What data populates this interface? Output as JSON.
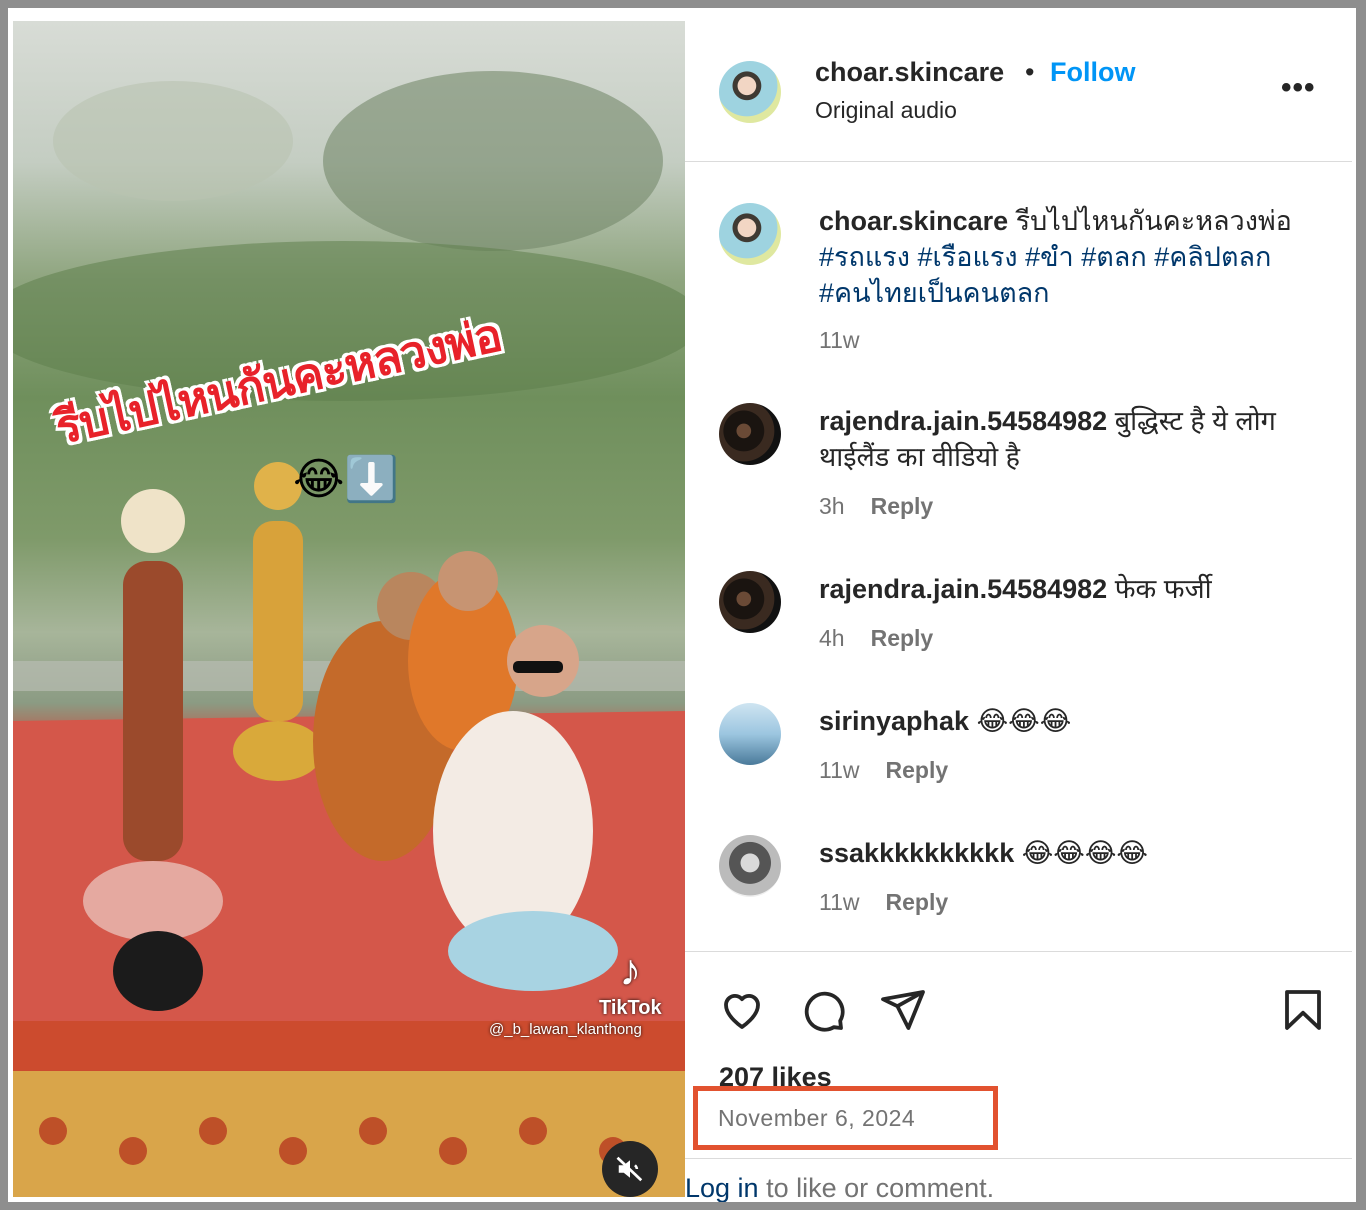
{
  "post": {
    "username": "choar.skincare",
    "follow_label": "Follow",
    "separator": "•",
    "audio": "Original audio",
    "more_label": "•••"
  },
  "media": {
    "overlay_text": "รีบไปไหนกันคะหลวงพ่อ",
    "overlay_emoji": "😂⬇️",
    "watermark_brand": "TikTok",
    "watermark_note": "♪",
    "watermark_handle": "@_b_lawan_klanthong",
    "muted": true
  },
  "caption": {
    "username": "choar.skincare",
    "text": "รีบไปไหนกันคะหลวงพ่อ",
    "hashtags": [
      "#รถแรง",
      "#เรือแรง",
      "#ขำ",
      "#ตลก",
      "#คลิปตลก",
      "#คนไทยเป็นคนตลก"
    ],
    "time": "11w"
  },
  "comments": [
    {
      "username": "rajendra.jain.54584982",
      "text": "बुद्धिस्ट है ये लोग थाईलैंड का वीडियो है",
      "time": "3h",
      "reply_label": "Reply"
    },
    {
      "username": "rajendra.jain.54584982",
      "text": "फेक फर्जी",
      "time": "4h",
      "reply_label": "Reply"
    },
    {
      "username": "sirinyaphak",
      "text": "😂😂😂",
      "time": "11w",
      "reply_label": "Reply"
    },
    {
      "username": "ssakkkkkkkkkk",
      "text": "😂😂😂😂",
      "time": "11w",
      "reply_label": "Reply"
    }
  ],
  "engagement": {
    "likes": "207 likes",
    "date": "November 6, 2024",
    "login_link": "Log in",
    "login_rest": " to like or comment."
  },
  "icons": [
    "heart-icon",
    "comment-icon",
    "share-icon",
    "bookmark-icon",
    "speaker-muted-icon",
    "more-icon"
  ],
  "colors": {
    "accent": "#0095f6",
    "hashtag": "#00376b",
    "highlight": "#e2522f"
  }
}
